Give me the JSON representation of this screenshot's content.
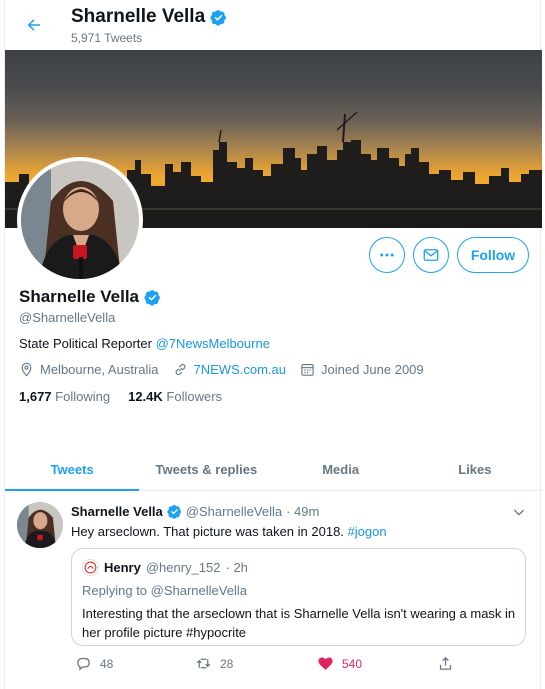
{
  "header": {
    "name": "Sharnelle Vella",
    "tweet_count": "5,971 Tweets"
  },
  "profile": {
    "name": "Sharnelle Vella",
    "handle": "@SharnelleVella",
    "bio_prefix": "State Political Reporter ",
    "bio_mention": "@7NewsMelbourne",
    "location": "Melbourne, Australia",
    "website": "7NEWS.com.au",
    "joined": "Joined June 2009",
    "following_count": "1,677",
    "following_label": "Following",
    "followers_count": "12.4K",
    "followers_label": "Followers",
    "follow_label": "Follow"
  },
  "tabs": [
    {
      "label": "Tweets",
      "active": true
    },
    {
      "label": "Tweets & replies"
    },
    {
      "label": "Media"
    },
    {
      "label": "Likes"
    }
  ],
  "tweet": {
    "author": "Sharnelle Vella",
    "handle": "@SharnelleVella",
    "time": "· 49m",
    "text": "Hey arseclown. That picture was taken in 2018. ",
    "hashtag": "#jogon",
    "quote": {
      "author": "Henry",
      "handle": "@henry_152",
      "time": "· 2h",
      "replying_to": "Replying to @SharnelleVella",
      "text": "Interesting that the arseclown that is Sharnelle Vella isn't wearing a mask in her profile picture #hypocrite"
    },
    "replies": "48",
    "retweets": "28",
    "likes": "540"
  },
  "colors": {
    "accent": "#1da1f2",
    "like": "#e0245e"
  }
}
